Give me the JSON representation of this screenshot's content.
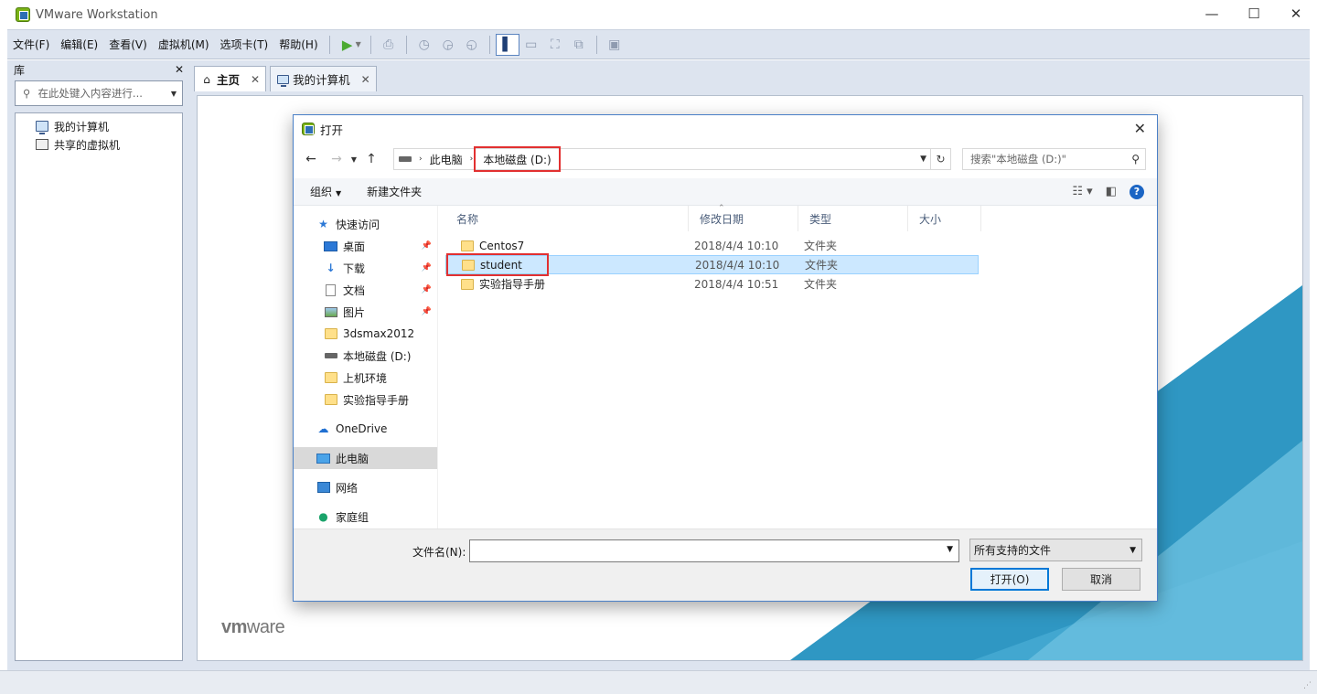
{
  "app": {
    "title": "VMware Workstation",
    "edge_mark": "<"
  },
  "window_controls": {
    "minimize": "—",
    "maximize": "☐",
    "close": "✕"
  },
  "menus": [
    "文件(F)",
    "编辑(E)",
    "查看(V)",
    "虚拟机(M)",
    "选项卡(T)",
    "帮助(H)"
  ],
  "library": {
    "header": "库",
    "close": "✕",
    "search_placeholder": "在此处键入内容进行...",
    "items": [
      "我的计算机",
      "共享的虚拟机"
    ]
  },
  "tabs": [
    {
      "label": "主页",
      "active": true
    },
    {
      "label": "我的计算机",
      "active": false
    }
  ],
  "home": {
    "logo_bold": "vm",
    "logo_rest": "ware"
  },
  "dialog": {
    "title": "打开",
    "close": "✕",
    "breadcrumbs": [
      "此电脑",
      "本地磁盘 (D:)"
    ],
    "search_placeholder": "搜索\"本地磁盘 (D:)\"",
    "organize": "组织",
    "new_folder": "新建文件夹",
    "help": "?",
    "nav": {
      "quick_access": "快速访问",
      "pinned": [
        "桌面",
        "下载",
        "文档",
        "图片"
      ],
      "folders": [
        "3dsmax2012",
        "本地磁盘 (D:)",
        "上机环境",
        "实验指导手册"
      ],
      "onedrive": "OneDrive",
      "this_pc": "此电脑",
      "network": "网络",
      "homegroup": "家庭组"
    },
    "columns": [
      "名称",
      "修改日期",
      "类型",
      "大小"
    ],
    "files": [
      {
        "name": "Centos7",
        "date": "2018/4/4 10:10",
        "type": "文件夹",
        "selected": false
      },
      {
        "name": "student",
        "date": "2018/4/4 10:10",
        "type": "文件夹",
        "selected": true
      },
      {
        "name": "实验指导手册",
        "date": "2018/4/4 10:51",
        "type": "文件夹",
        "selected": false
      }
    ],
    "filename_label": "文件名(N):",
    "filename_value": "",
    "filter": "所有支持的文件",
    "open_button": "打开(O)",
    "cancel_button": "取消"
  }
}
